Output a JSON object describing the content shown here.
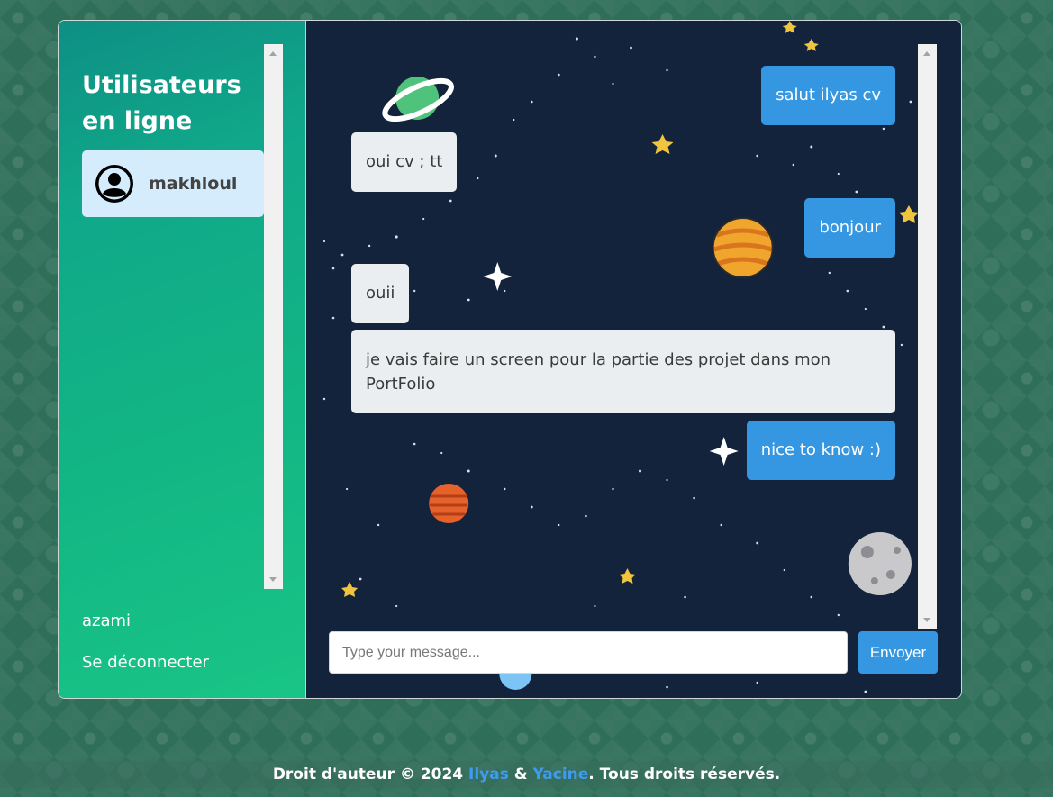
{
  "sidebar": {
    "title": "Utilisateurs en ligne",
    "users": [
      {
        "name": "makhloul",
        "icon": "user-circle-icon"
      }
    ],
    "current_user": "azami",
    "logout_label": "Se déconnecter"
  },
  "chat": {
    "messages": [
      {
        "direction": "sent",
        "text": "salut ilyas cv"
      },
      {
        "direction": "received",
        "text": "oui cv ; tt"
      },
      {
        "direction": "sent",
        "text": "bonjour"
      },
      {
        "direction": "received",
        "text": "ouii"
      },
      {
        "direction": "received",
        "text": "je vais faire un screen pour la partie des projet dans mon PortFolio"
      },
      {
        "direction": "sent",
        "text": "nice to know :)"
      }
    ],
    "input_placeholder": "Type your message...",
    "send_label": "Envoyer",
    "background_theme": "space-planets"
  },
  "footer": {
    "prefix": "Droit d'auteur © 2024 ",
    "author1": "Ilyas",
    "separator": " & ",
    "author2": "Yacine",
    "suffix": ". Tous droits réservés."
  },
  "colors": {
    "sent_bubble": "#3597e1",
    "received_bubble": "#ebeef0",
    "sidebar_gradient_start": "#0e8f84",
    "sidebar_gradient_end": "#19c586",
    "chat_background": "#13233c",
    "link": "#3e9cf0"
  }
}
